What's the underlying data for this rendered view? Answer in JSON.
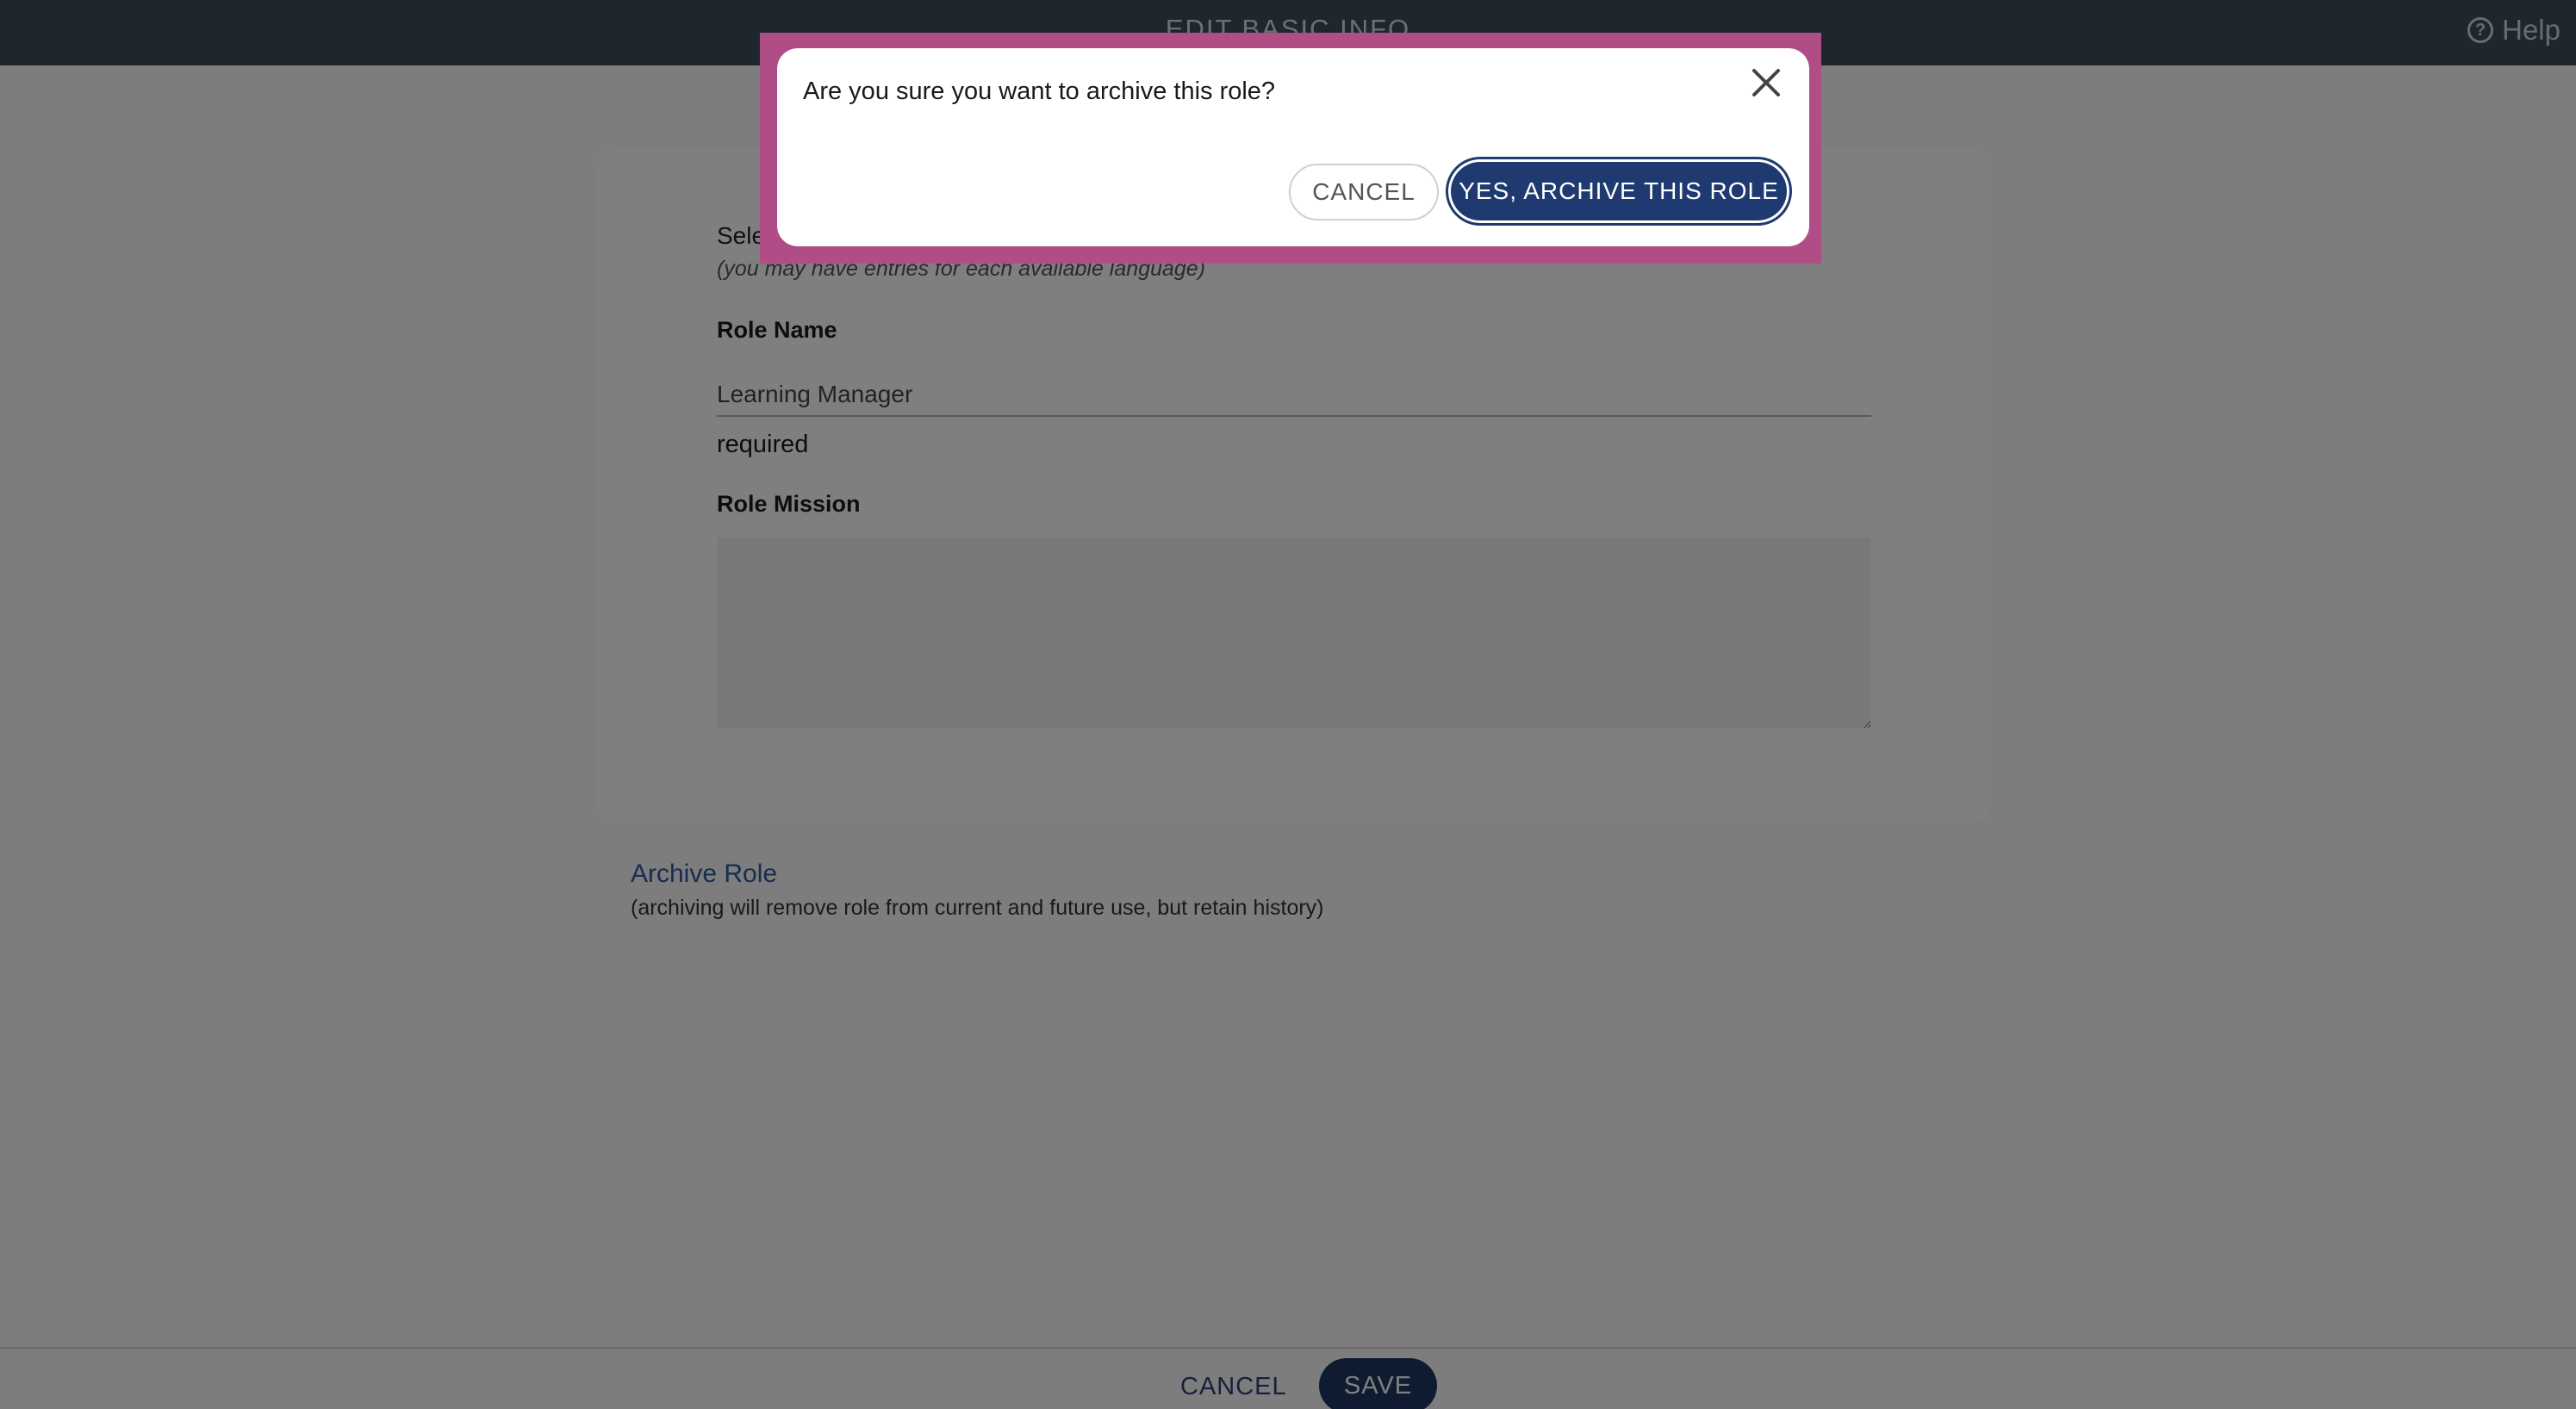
{
  "header": {
    "title": "EDIT BASIC INFO",
    "help_label": "Help",
    "help_icon": "question-circle-icon"
  },
  "form": {
    "language_select_label": "Select language",
    "language_hint": "(you may have entries for each available language)",
    "role_name_label": "Role Name",
    "role_name_value": "Learning Manager",
    "required_text": "required",
    "role_mission_label": "Role Mission",
    "role_mission_value": ""
  },
  "archive": {
    "link_label": "Archive Role",
    "note": "(archiving will remove role from current and future use, but retain history)"
  },
  "footer": {
    "cancel_label": "CANCEL",
    "save_label": "SAVE"
  },
  "dialog": {
    "message": "Are you sure you want to archive this role?",
    "close_icon": "close-icon",
    "cancel_label": "CANCEL",
    "confirm_label": "YES, ARCHIVE THIS ROLE"
  },
  "colors": {
    "header_bg": "#3d4f5d",
    "primary_button": "#1d3663",
    "link": "#2d5a9e",
    "focus_frame": "#b04d86"
  }
}
